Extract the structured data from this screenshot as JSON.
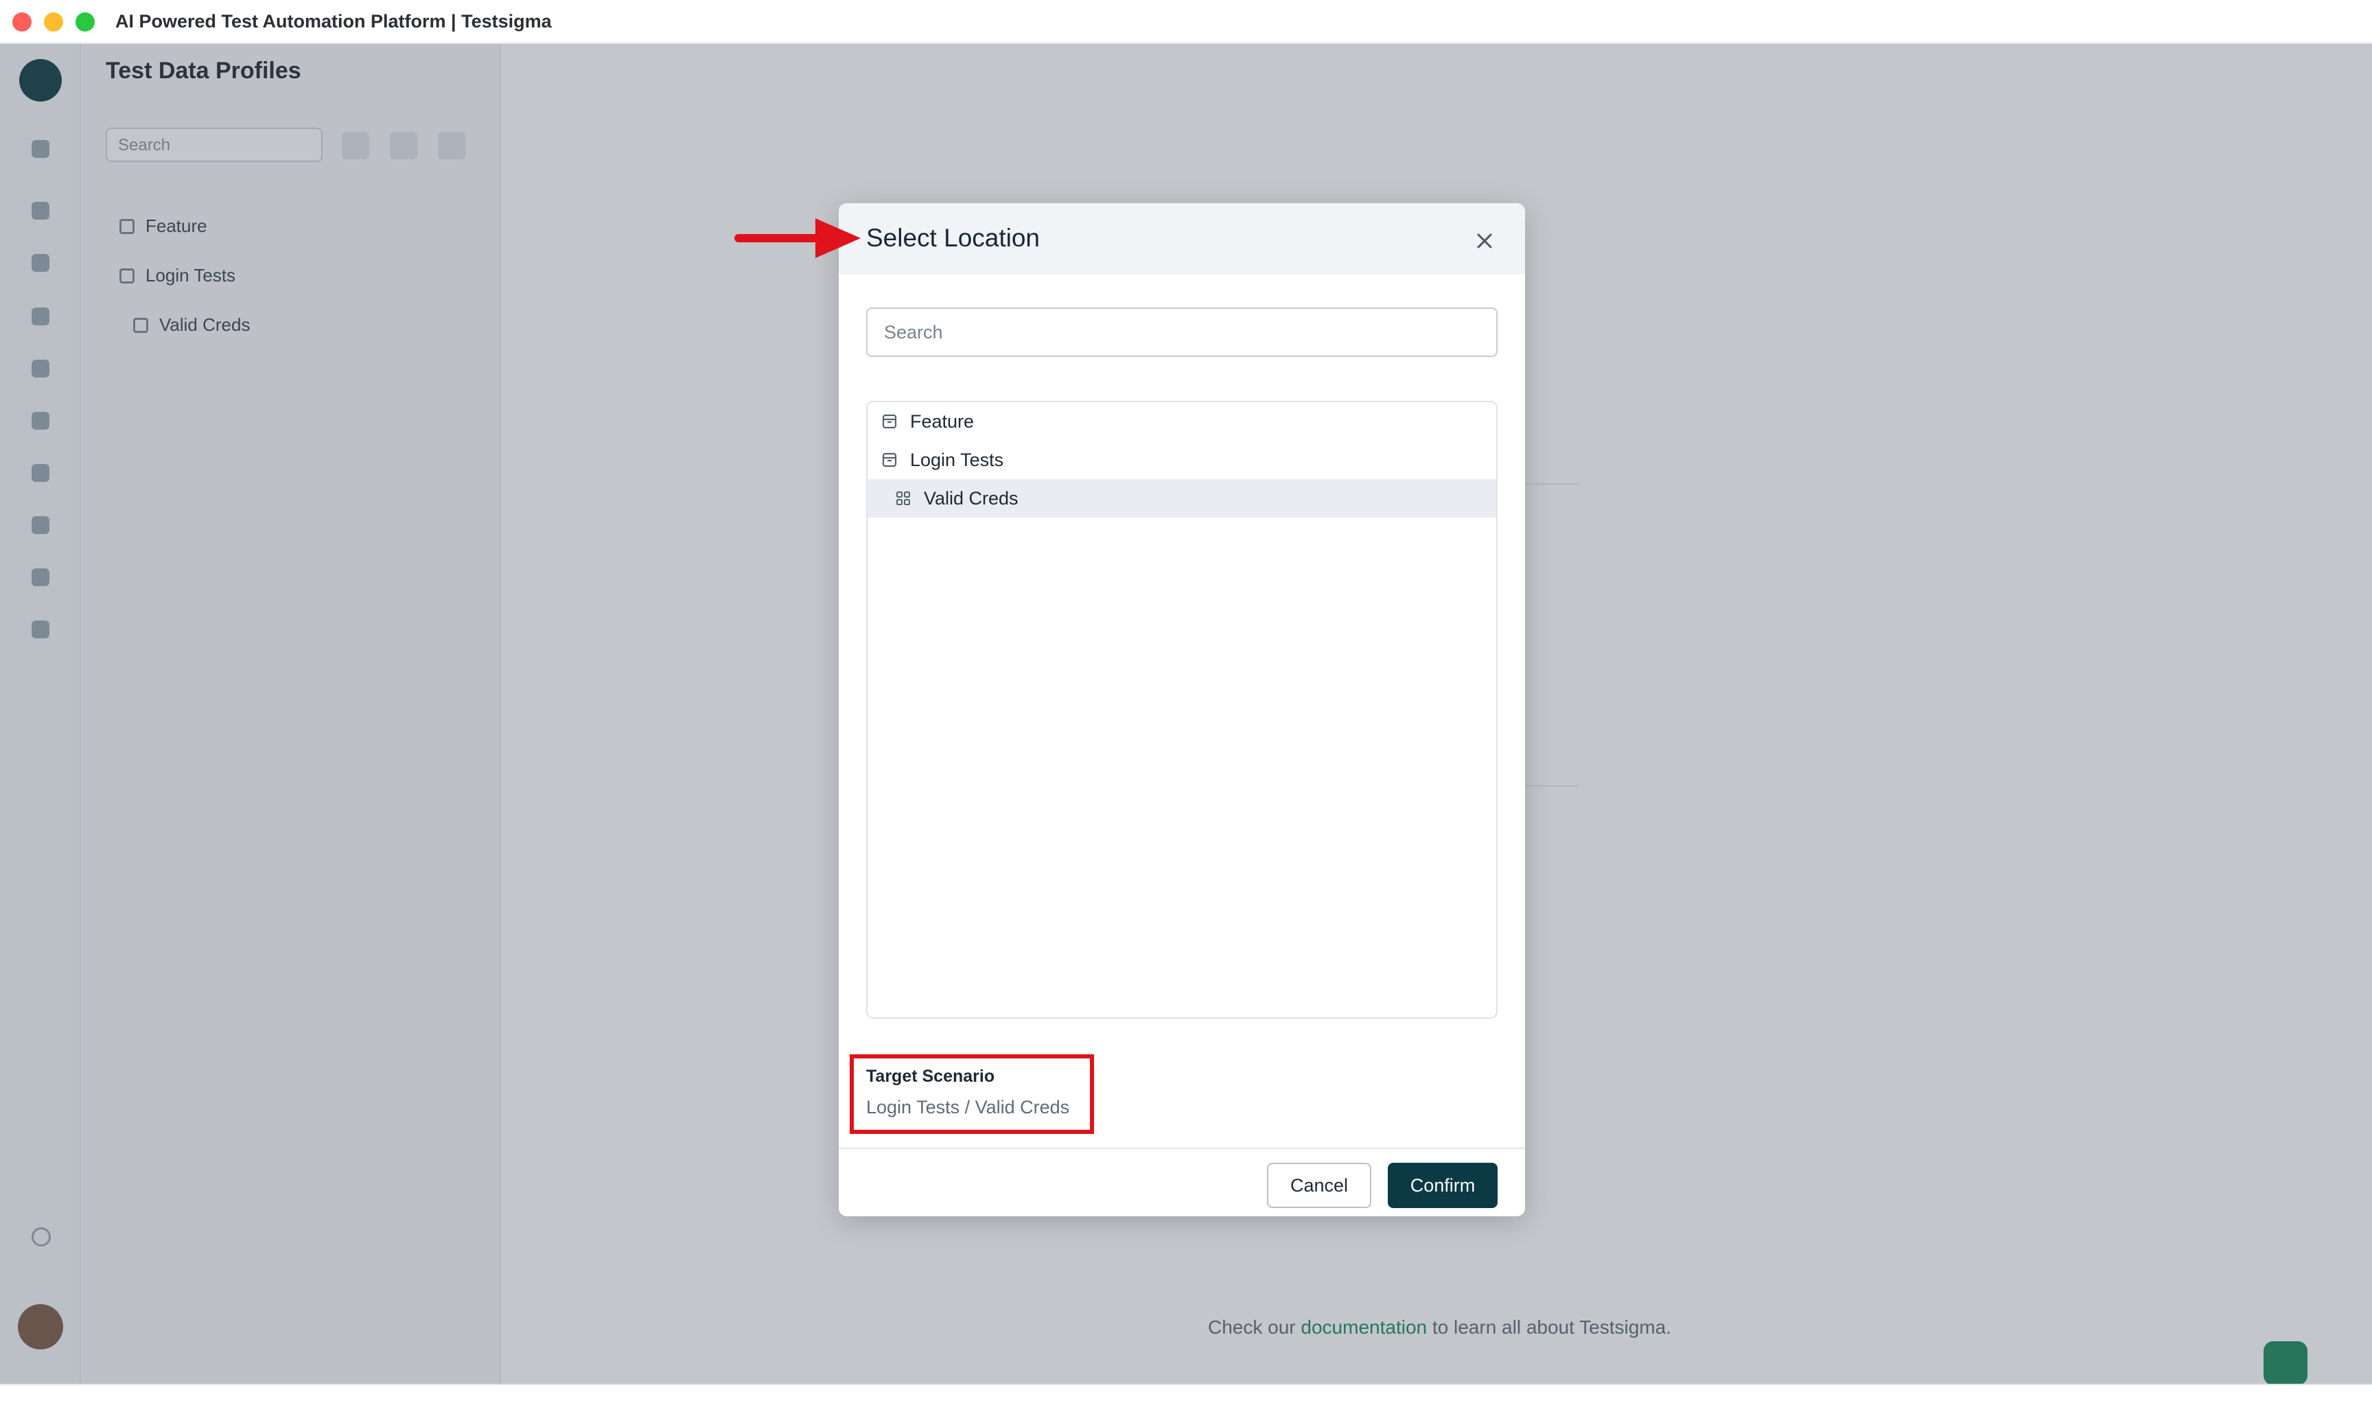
{
  "window": {
    "title": "AI Powered Test Automation Platform | Testsigma"
  },
  "background": {
    "panel_title": "Test Data Profiles",
    "search_placeholder": "Search",
    "tree": [
      {
        "label": "Feature"
      },
      {
        "label": "Login Tests"
      },
      {
        "label": "Valid Creds"
      }
    ],
    "footer_text_before": "Check our ",
    "footer_link": "documentation",
    "footer_text_after": " to learn all about Testsigma."
  },
  "modal": {
    "title": "Select Location",
    "search_placeholder": "Search",
    "tree": [
      {
        "label": "Feature",
        "icon": "folder-icon",
        "selected": false
      },
      {
        "label": "Login Tests",
        "icon": "folder-icon",
        "selected": false
      },
      {
        "label": "Valid Creds",
        "icon": "grid-icon",
        "selected": true
      }
    ],
    "target_label": "Target Scenario",
    "target_value": "Login Tests / Valid Creds",
    "cancel_label": "Cancel",
    "confirm_label": "Confirm"
  },
  "colors": {
    "primary": "#0b3a45",
    "annotation": "#e0121b",
    "header_bg": "#f1f4f7",
    "selected_row": "#e9ecf0"
  }
}
